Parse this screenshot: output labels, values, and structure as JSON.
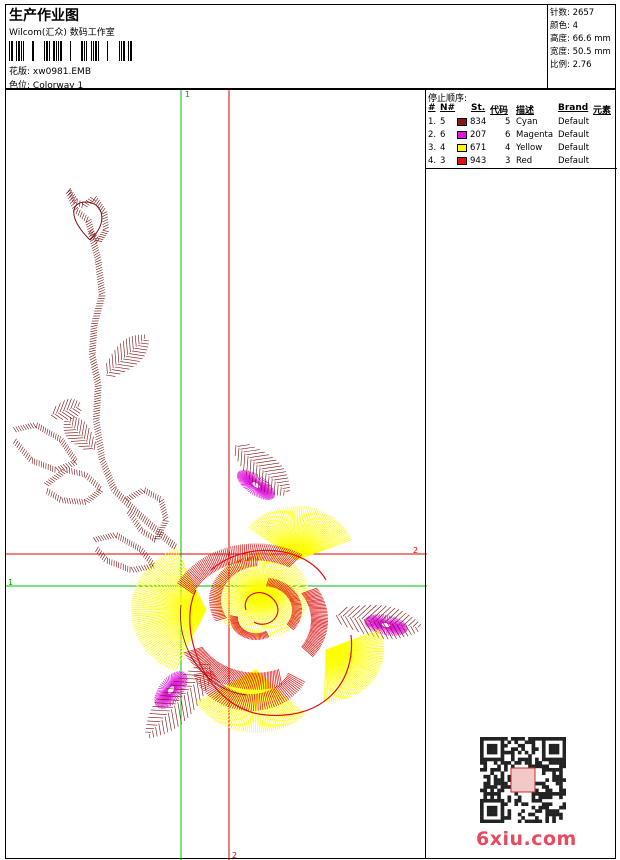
{
  "header": {
    "title": "生产作业图",
    "subtitle": "Wilcom(汇众) 数码工作室",
    "design_label": "花版:",
    "design_value": "xw0981.EMB",
    "colorway_label": "色位:",
    "colorway_value": "Colorway 1"
  },
  "stats": [
    {
      "label": "针数:",
      "value": "2657"
    },
    {
      "label": "颜色:",
      "value": "4"
    },
    {
      "label": "高度:",
      "value": "66.6 mm"
    },
    {
      "label": "宽度:",
      "value": "50.5 mm"
    },
    {
      "label": "比例:",
      "value": "2.76"
    }
  ],
  "stop_sequence": {
    "title": "停止顺序:",
    "columns": [
      "#",
      "N#",
      "St.",
      "代码",
      "描述",
      "Brand",
      "元素"
    ],
    "rows": [
      {
        "num": "1.",
        "n": "5",
        "color": "#8b1414",
        "stitches": "834",
        "code": "5",
        "desc": "Cyan",
        "brand": "Default"
      },
      {
        "num": "2.",
        "n": "6",
        "color": "#e014e0",
        "stitches": "207",
        "code": "6",
        "desc": "Magenta",
        "brand": "Default"
      },
      {
        "num": "3.",
        "n": "4",
        "color": "#ffff00",
        "stitches": "671",
        "code": "4",
        "desc": "Yellow",
        "brand": "Default"
      },
      {
        "num": "4.",
        "n": "3",
        "color": "#e01010",
        "stitches": "943",
        "code": "3",
        "desc": "Red",
        "brand": "Default"
      }
    ]
  },
  "axes": {
    "green_v": "1",
    "green_h": "1",
    "red_v": "2",
    "red_h": "2"
  },
  "watermark": "6xiu.com",
  "colors": {
    "branch": "#7a0e0e",
    "magenta": "#e014e0",
    "yellow": "#ffff00",
    "red": "#e01010",
    "green_axis": "#00c000",
    "red_axis": "#e00000"
  }
}
